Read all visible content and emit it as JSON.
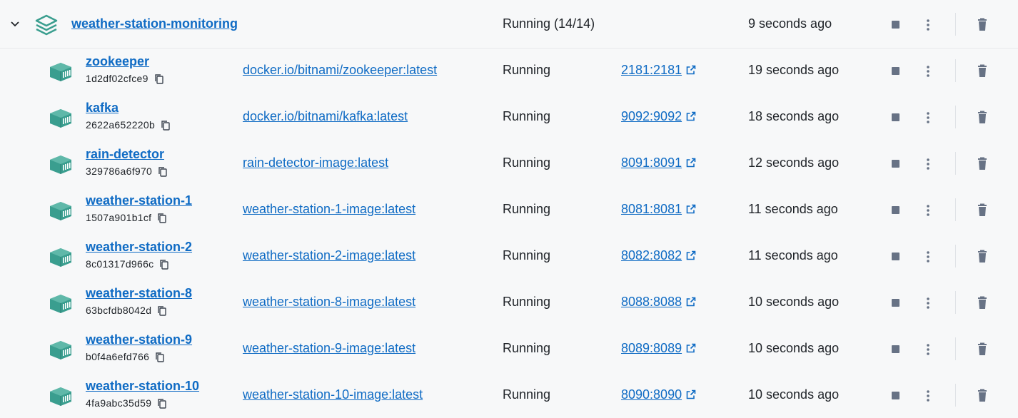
{
  "group": {
    "name": "weather-station-monitoring",
    "status": "Running (14/14)",
    "time": "9 seconds ago"
  },
  "containers": [
    {
      "name": "zookeeper",
      "id": "1d2df02cfce9",
      "image": "docker.io/bitnami/zookeeper:latest",
      "status": "Running",
      "port": "2181:2181",
      "time": "19 seconds ago"
    },
    {
      "name": "kafka",
      "id": "2622a652220b",
      "image": "docker.io/bitnami/kafka:latest",
      "status": "Running",
      "port": "9092:9092",
      "time": "18 seconds ago"
    },
    {
      "name": "rain-detector",
      "id": "329786a6f970",
      "image": "rain-detector-image:latest",
      "status": "Running",
      "port": "8091:8091",
      "time": "12 seconds ago"
    },
    {
      "name": "weather-station-1",
      "id": "1507a901b1cf",
      "image": "weather-station-1-image:latest",
      "status": "Running",
      "port": "8081:8081",
      "time": "11 seconds ago"
    },
    {
      "name": "weather-station-2",
      "id": "8c01317d966c",
      "image": "weather-station-2-image:latest",
      "status": "Running",
      "port": "8082:8082",
      "time": "11 seconds ago"
    },
    {
      "name": "weather-station-8",
      "id": "63bcfdb8042d",
      "image": "weather-station-8-image:latest",
      "status": "Running",
      "port": "8088:8088",
      "time": "10 seconds ago"
    },
    {
      "name": "weather-station-9",
      "id": "b0f4a6efd766",
      "image": "weather-station-9-image:latest",
      "status": "Running",
      "port": "8089:8089",
      "time": "10 seconds ago"
    },
    {
      "name": "weather-station-10",
      "id": "4fa9abc35d59",
      "image": "weather-station-10-image:latest",
      "status": "Running",
      "port": "8090:8090",
      "time": "10 seconds ago"
    }
  ],
  "icons": {
    "expand": "chevron-down-icon",
    "group": "stack-icon",
    "container": "container-icon",
    "copy": "copy-icon",
    "external": "external-link-icon",
    "stop": "stop-icon",
    "more": "more-vertical-icon",
    "delete": "trash-icon"
  },
  "colors": {
    "link": "#0f6bc4",
    "container_icon": "#3a9e8f",
    "action_icon": "#677285",
    "background": "#f7f8f9"
  }
}
